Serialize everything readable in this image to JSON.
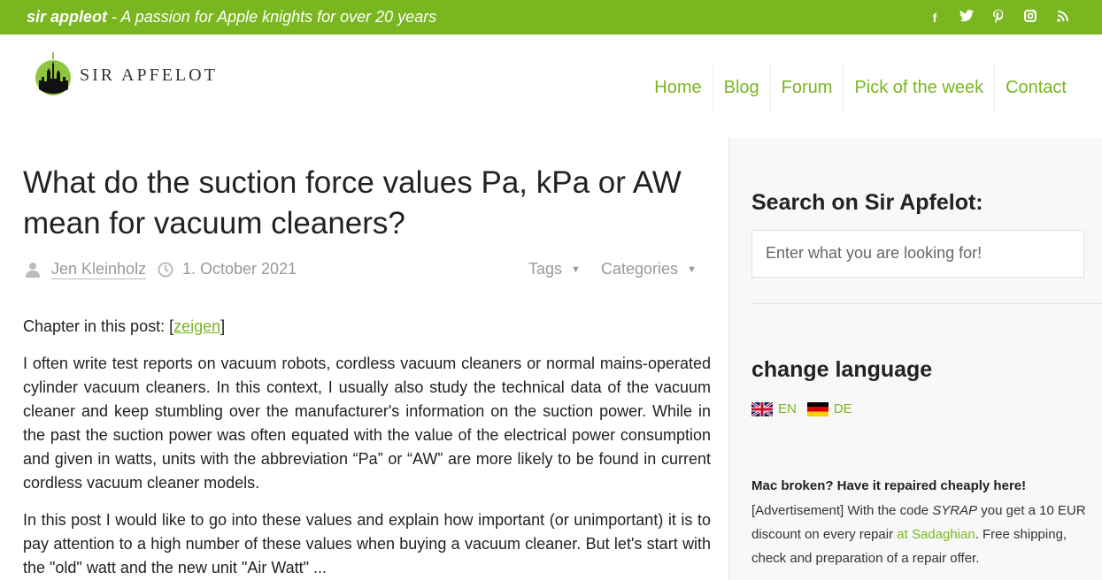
{
  "topbar": {
    "brand": "sir appleot",
    "tagline": " - A passion for Apple knights for over 20 years",
    "social_icons": [
      "facebook-icon",
      "twitter-icon",
      "pinterest-icon",
      "instagram-icon",
      "rss-icon"
    ],
    "color": "#7ab620"
  },
  "logo": {
    "text": "SIR APFELOT"
  },
  "nav": {
    "items": [
      {
        "label": "Home"
      },
      {
        "label": "Blog"
      },
      {
        "label": "Forum"
      },
      {
        "label": "Pick of the week"
      },
      {
        "label": "Contact"
      }
    ]
  },
  "article": {
    "title": "What do the suction force values Pa, kPa or AW mean for vacuum cleaners?",
    "author": "Jen Kleinholz",
    "date": "1. October 2021",
    "tags_label": "Tags",
    "categories_label": "Categories",
    "chapter_prefix": "Chapter in this post: [",
    "chapter_toggle": "zeigen",
    "chapter_suffix": "]",
    "paragraph1": "I often write test reports on vacuum robots, cordless vacuum cleaners or normal mains-operated cylinder vacuum cleaners. In this context, I usually also study the technical data of the vacuum cleaner and keep stumbling over the manufacturer's information on the suction power. While in the past the suction power was often equated with the value of the electrical power consumption and given in watts, units with the abbreviation “Pa” or “AW” are more likely to be found in current cordless vacuum cleaner models.",
    "paragraph2": "In this post I would like to go into these values and explain how important (or unimportant) it is to pay attention to a high number of these values when buying a vacuum cleaner. But let's start with the \"old\" watt and the new unit \"Air Watt\" ..."
  },
  "sidebar": {
    "search_title": "Search on Sir Apfelot:",
    "search_placeholder": "Enter what you are looking for!",
    "lang_title": "change language",
    "languages": [
      {
        "code": "EN",
        "flag": "uk-flag-icon"
      },
      {
        "code": "DE",
        "flag": "germany-flag-icon"
      }
    ],
    "ad_title": "Mac broken? Have it repaired cheaply here!",
    "ad_text_1": "[Advertisement] With the code ",
    "ad_code": "SYRAP",
    "ad_text_2": " you get a 10 EUR discount on every repair ",
    "ad_link": "at Sadaghian",
    "ad_text_3": ". Free shipping, check and preparation of a repair offer."
  }
}
